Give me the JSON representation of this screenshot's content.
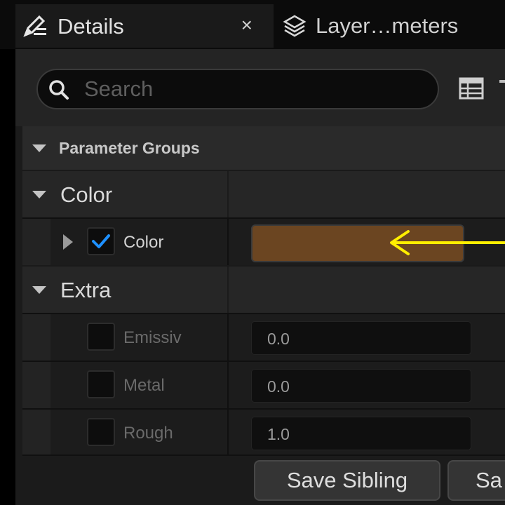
{
  "tabs": [
    {
      "label": "Details",
      "icon": "pencil-list-icon",
      "active": true,
      "close_label": "×"
    },
    {
      "label": "Layer…meters",
      "icon": "layers-icon",
      "active": false
    }
  ],
  "search": {
    "placeholder": "Search",
    "value": ""
  },
  "parameter_groups": {
    "label": "Parameter Groups"
  },
  "categories": {
    "color": {
      "label": "Color",
      "properties": [
        {
          "label": "Color",
          "enabled": true,
          "value_color": "#6b4521"
        }
      ]
    },
    "extra": {
      "label": "Extra",
      "properties": [
        {
          "label": "Emissiv",
          "enabled": false,
          "value": "0.0"
        },
        {
          "label": "Metal",
          "enabled": false,
          "value": "0.0"
        },
        {
          "label": "Rough",
          "enabled": false,
          "value": "1.0"
        }
      ]
    }
  },
  "buttons": {
    "save_sibling": "Save Sibling",
    "save_partial": "Sa"
  },
  "colors": {
    "accent_check": "#1e90ff",
    "annotation_arrow": "#ffee00",
    "swatch": "#6b4521"
  }
}
